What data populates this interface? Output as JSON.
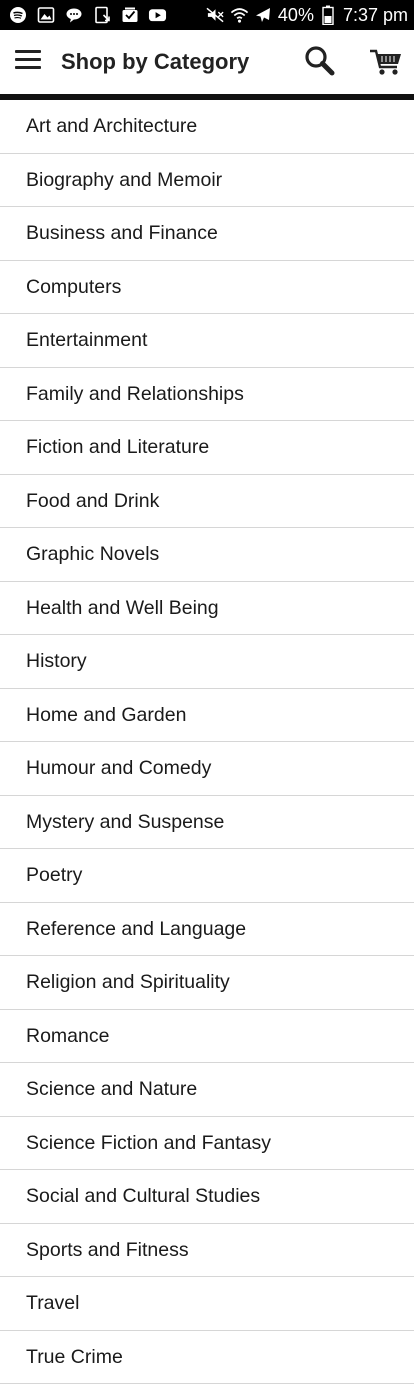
{
  "status_bar": {
    "battery": "40%",
    "time": "7:37 pm",
    "left_icons": [
      "spotify-icon",
      "gallery-icon",
      "chat-icon",
      "download-icon",
      "inbox-icon",
      "youtube-icon"
    ],
    "right_icons": [
      "mute-icon",
      "wifi-icon",
      "airplane-icon",
      "battery-icon"
    ]
  },
  "app_bar": {
    "title": "Shop by Category",
    "menu_icon": "hamburger-menu-icon",
    "search_icon": "search-icon",
    "cart_icon": "cart-icon"
  },
  "categories": [
    "Art and Architecture",
    "Biography and Memoir",
    "Business and Finance",
    "Computers",
    "Entertainment",
    "Family and Relationships",
    "Fiction and Literature",
    "Food and Drink",
    "Graphic Novels",
    "Health and Well Being",
    "History",
    "Home and Garden",
    "Humour and Comedy",
    "Mystery and Suspense",
    "Poetry",
    "Reference and Language",
    "Religion and Spirituality",
    "Romance",
    "Science and Nature",
    "Science Fiction and Fantasy",
    "Social and Cultural Studies",
    "Sports and Fitness",
    "Travel",
    "True Crime"
  ],
  "colors": {
    "status_bar_bg": "#000000",
    "app_bar_bg": "#ffffff",
    "divider": "#d6d6d6",
    "text": "#1a1a1a"
  }
}
